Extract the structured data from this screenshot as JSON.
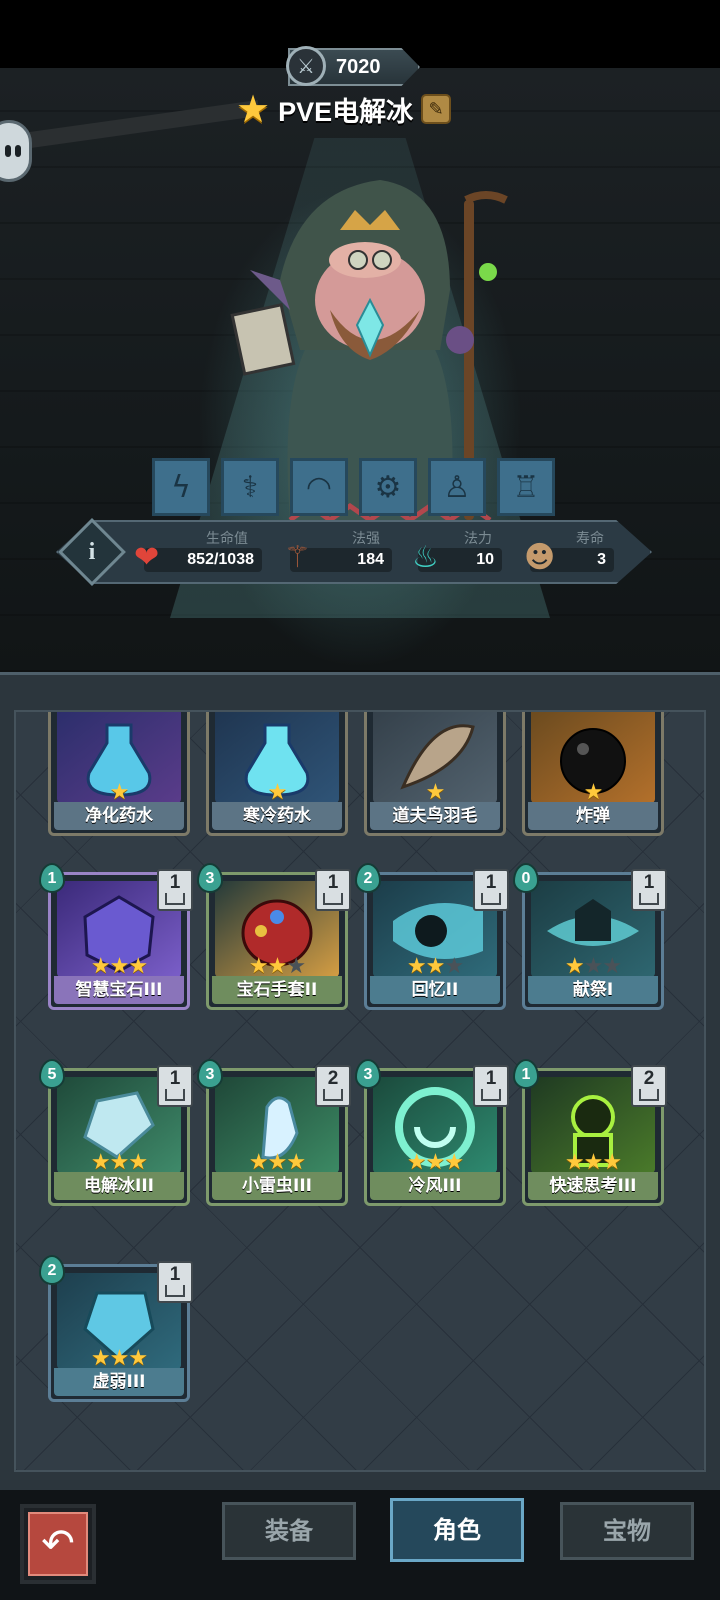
{
  "hero": {
    "power": "7020",
    "name": "PVE电解冰",
    "traits": [
      "lightning-icon",
      "caduceus-icon",
      "flex-arm-icon",
      "gear-brain-icon",
      "kneel-icon",
      "spear-figure-icon"
    ]
  },
  "stats": {
    "hp": {
      "label": "生命值",
      "value": "852/1038"
    },
    "spell_power": {
      "label": "法强",
      "value": "184"
    },
    "mana": {
      "label": "法力",
      "value": "10"
    },
    "lifespan": {
      "label": "寿命",
      "value": "3"
    }
  },
  "cards": [
    {
      "name": "净化药水",
      "stars": 1,
      "max_stars": 1,
      "theme": "gold",
      "art": "potion-blue"
    },
    {
      "name": "寒冷药水",
      "stars": 1,
      "max_stars": 1,
      "theme": "gold",
      "art": "potion-cyan"
    },
    {
      "name": "道夫鸟羽毛",
      "stars": 1,
      "max_stars": 1,
      "theme": "gold",
      "art": "feather"
    },
    {
      "name": "炸弹",
      "stars": 1,
      "max_stars": 1,
      "theme": "gold",
      "art": "bomb"
    },
    {
      "name": "智慧宝石III",
      "cost": "1",
      "count": "1",
      "stars": 3,
      "max_stars": 3,
      "theme": "purple",
      "art": "gem"
    },
    {
      "name": "宝石手套II",
      "cost": "3",
      "count": "1",
      "stars": 2,
      "max_stars": 3,
      "theme": "green",
      "art": "gauntlet"
    },
    {
      "name": "回忆II",
      "cost": "2",
      "count": "1",
      "stars": 2,
      "max_stars": 3,
      "theme": "blue",
      "art": "memory"
    },
    {
      "name": "献祭I",
      "cost": "0",
      "count": "1",
      "stars": 1,
      "max_stars": 3,
      "theme": "blue",
      "art": "sacrifice"
    },
    {
      "name": "电解冰III",
      "cost": "5",
      "count": "1",
      "stars": 3,
      "max_stars": 3,
      "theme": "green",
      "art": "ice-cube"
    },
    {
      "name": "小雷虫III",
      "cost": "3",
      "count": "2",
      "stars": 3,
      "max_stars": 3,
      "theme": "green",
      "art": "thunder-bug"
    },
    {
      "name": "冷风III",
      "cost": "3",
      "count": "1",
      "stars": 3,
      "max_stars": 3,
      "theme": "green",
      "art": "cold-wind"
    },
    {
      "name": "快速思考III",
      "cost": "1",
      "count": "2",
      "stars": 3,
      "max_stars": 3,
      "theme": "green",
      "art": "quick-think"
    },
    {
      "name": "虚弱III",
      "cost": "2",
      "count": "1",
      "stars": 3,
      "max_stars": 3,
      "theme": "blue",
      "art": "weakness"
    }
  ],
  "nav": {
    "tabs": [
      {
        "label": "装备",
        "active": false
      },
      {
        "label": "角色",
        "active": true
      },
      {
        "label": "宝物",
        "active": false
      }
    ]
  }
}
